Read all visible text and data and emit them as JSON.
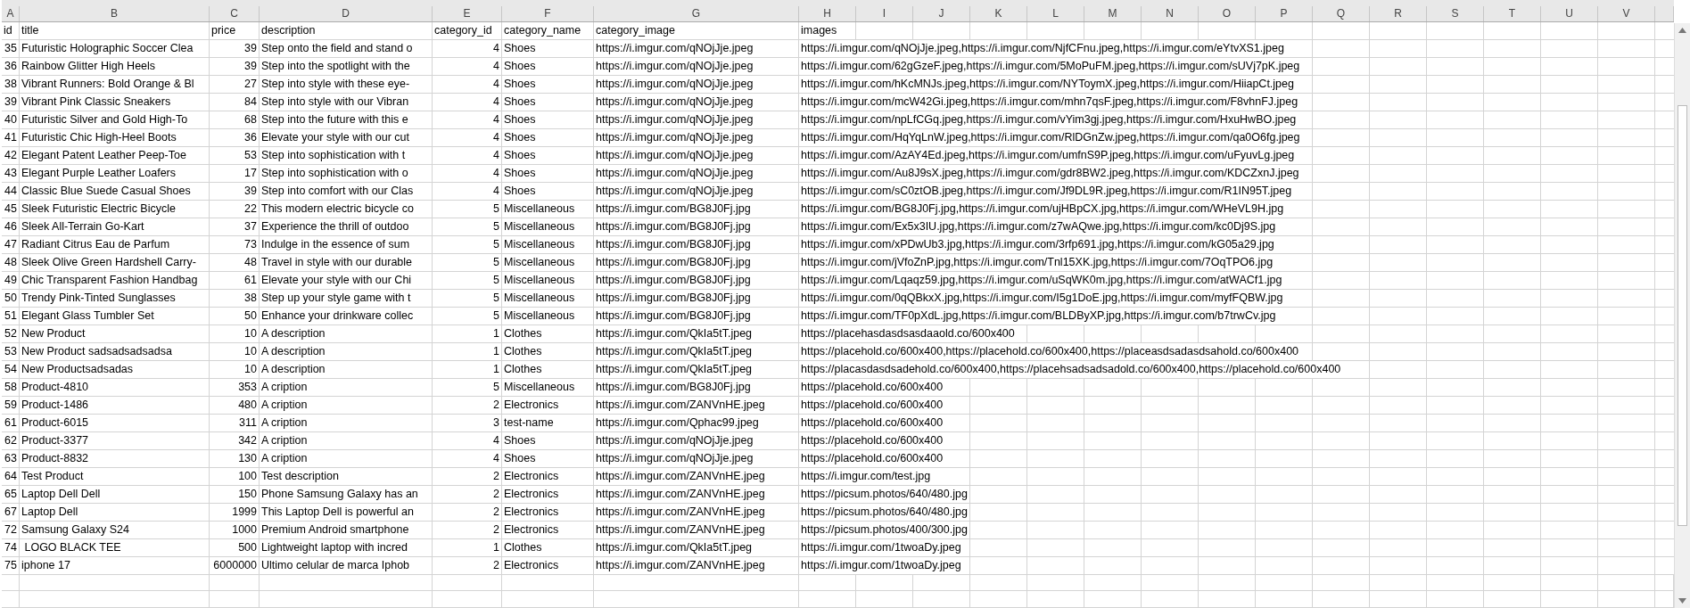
{
  "column_headers": [
    "A",
    "B",
    "C",
    "D",
    "E",
    "F",
    "G",
    "H",
    "I",
    "J",
    "K",
    "L",
    "M",
    "N",
    "O",
    "P",
    "Q",
    "R",
    "S",
    "T",
    "U",
    "V"
  ],
  "table": {
    "columns": [
      "id",
      "title",
      "price",
      "description",
      "category_id",
      "category_name",
      "category_image",
      "images"
    ],
    "rows": [
      [
        "35",
        "Futuristic Holographic Soccer Clea",
        "39",
        "Step onto the field and stand o",
        "4",
        "Shoes",
        "https://i.imgur.com/qNOjJje.jpeg",
        "https://i.imgur.com/qNOjJje.jpeg,https://i.imgur.com/NjfCFnu.jpeg,https://i.imgur.com/eYtvXS1.jpeg"
      ],
      [
        "36",
        "Rainbow Glitter High Heels",
        "39",
        "Step into the spotlight with the",
        "4",
        "Shoes",
        "https://i.imgur.com/qNOjJje.jpeg",
        "https://i.imgur.com/62gGzeF.jpeg,https://i.imgur.com/5MoPuFM.jpeg,https://i.imgur.com/sUVj7pK.jpeg"
      ],
      [
        "38",
        "Vibrant Runners: Bold Orange & Bl",
        "27",
        "Step into style with these eye-",
        "4",
        "Shoes",
        "https://i.imgur.com/qNOjJje.jpeg",
        "https://i.imgur.com/hKcMNJs.jpeg,https://i.imgur.com/NYToymX.jpeg,https://i.imgur.com/HiiapCt.jpeg"
      ],
      [
        "39",
        "Vibrant Pink Classic Sneakers",
        "84",
        "Step into style with our Vibran",
        "4",
        "Shoes",
        "https://i.imgur.com/qNOjJje.jpeg",
        "https://i.imgur.com/mcW42Gi.jpeg,https://i.imgur.com/mhn7qsF.jpeg,https://i.imgur.com/F8vhnFJ.jpeg"
      ],
      [
        "40",
        "Futuristic Silver and Gold High-To",
        "68",
        "Step into the future with this e",
        "4",
        "Shoes",
        "https://i.imgur.com/qNOjJje.jpeg",
        "https://i.imgur.com/npLfCGq.jpeg,https://i.imgur.com/vYim3gj.jpeg,https://i.imgur.com/HxuHwBO.jpeg"
      ],
      [
        "41",
        "Futuristic Chic High-Heel Boots",
        "36",
        "Elevate your style with our cut",
        "4",
        "Shoes",
        "https://i.imgur.com/qNOjJje.jpeg",
        "https://i.imgur.com/HqYqLnW.jpeg,https://i.imgur.com/RlDGnZw.jpeg,https://i.imgur.com/qa0O6fg.jpeg"
      ],
      [
        "42",
        "Elegant Patent Leather Peep-Toe",
        "53",
        "Step into sophistication with t",
        "4",
        "Shoes",
        "https://i.imgur.com/qNOjJje.jpeg",
        "https://i.imgur.com/AzAY4Ed.jpeg,https://i.imgur.com/umfnS9P.jpeg,https://i.imgur.com/uFyuvLg.jpeg"
      ],
      [
        "43",
        "Elegant Purple Leather Loafers",
        "17",
        "Step into sophistication with o",
        "4",
        "Shoes",
        "https://i.imgur.com/qNOjJje.jpeg",
        "https://i.imgur.com/Au8J9sX.jpeg,https://i.imgur.com/gdr8BW2.jpeg,https://i.imgur.com/KDCZxnJ.jpeg"
      ],
      [
        "44",
        "Classic Blue Suede Casual Shoes",
        "39",
        "Step into comfort with our Clas",
        "4",
        "Shoes",
        "https://i.imgur.com/qNOjJje.jpeg",
        "https://i.imgur.com/sC0ztOB.jpeg,https://i.imgur.com/Jf9DL9R.jpeg,https://i.imgur.com/R1IN95T.jpeg"
      ],
      [
        "45",
        "Sleek Futuristic Electric Bicycle",
        "22",
        "This modern electric bicycle co",
        "5",
        "Miscellaneous",
        "https://i.imgur.com/BG8J0Fj.jpg",
        "https://i.imgur.com/BG8J0Fj.jpg,https://i.imgur.com/ujHBpCX.jpg,https://i.imgur.com/WHeVL9H.jpg"
      ],
      [
        "46",
        "Sleek All-Terrain Go-Kart",
        "37",
        "Experience the thrill of outdoo",
        "5",
        "Miscellaneous",
        "https://i.imgur.com/BG8J0Fj.jpg",
        "https://i.imgur.com/Ex5x3IU.jpg,https://i.imgur.com/z7wAQwe.jpg,https://i.imgur.com/kc0Dj9S.jpg"
      ],
      [
        "47",
        "Radiant Citrus Eau de Parfum",
        "73",
        "Indulge in the essence of sum",
        "5",
        "Miscellaneous",
        "https://i.imgur.com/BG8J0Fj.jpg",
        "https://i.imgur.com/xPDwUb3.jpg,https://i.imgur.com/3rfp691.jpg,https://i.imgur.com/kG05a29.jpg"
      ],
      [
        "48",
        "Sleek Olive Green Hardshell Carry-",
        "48",
        "Travel in style with our durable",
        "5",
        "Miscellaneous",
        "https://i.imgur.com/BG8J0Fj.jpg",
        "https://i.imgur.com/jVfoZnP.jpg,https://i.imgur.com/Tnl15XK.jpg,https://i.imgur.com/7OqTPO6.jpg"
      ],
      [
        "49",
        "Chic Transparent Fashion Handbag",
        "61",
        "Elevate your style with our Chi",
        "5",
        "Miscellaneous",
        "https://i.imgur.com/BG8J0Fj.jpg",
        "https://i.imgur.com/Lqaqz59.jpg,https://i.imgur.com/uSqWK0m.jpg,https://i.imgur.com/atWACf1.jpg"
      ],
      [
        "50",
        "Trendy Pink-Tinted Sunglasses",
        "38",
        "Step up your style game with t",
        "5",
        "Miscellaneous",
        "https://i.imgur.com/BG8J0Fj.jpg",
        "https://i.imgur.com/0qQBkxX.jpg,https://i.imgur.com/I5g1DoE.jpg,https://i.imgur.com/myfFQBW.jpg"
      ],
      [
        "51",
        "Elegant Glass Tumbler Set",
        "50",
        "Enhance your drinkware collec",
        "5",
        "Miscellaneous",
        "https://i.imgur.com/BG8J0Fj.jpg",
        "https://i.imgur.com/TF0pXdL.jpg,https://i.imgur.com/BLDByXP.jpg,https://i.imgur.com/b7trwCv.jpg"
      ],
      [
        "52",
        "New Product",
        "10",
        "A description",
        "1",
        "Clothes",
        "https://i.imgur.com/QkIa5tT.jpeg",
        "https://placehasdasdsasdaaold.co/600x400"
      ],
      [
        "53",
        "New Product sadsadsadsadsa",
        "10",
        "A description",
        "1",
        "Clothes",
        "https://i.imgur.com/QkIa5tT.jpeg",
        "https://placehold.co/600x400,https://placehold.co/600x400,https://placeasdsadasdsahold.co/600x400"
      ],
      [
        "54",
        "New Productsadsadas",
        "10",
        "A description",
        "1",
        "Clothes",
        "https://i.imgur.com/QkIa5tT.jpeg",
        "https://placasdasdsadehold.co/600x400,https://placehsadsadsadold.co/600x400,https://placehold.co/600x400"
      ],
      [
        "58",
        "Product-4810",
        "353",
        "A cription",
        "5",
        "Miscellaneous",
        "https://i.imgur.com/BG8J0Fj.jpg",
        "https://placehold.co/600x400"
      ],
      [
        "59",
        "Product-1486",
        "480",
        "A cription",
        "2",
        "Electronics",
        "https://i.imgur.com/ZANVnHE.jpeg",
        "https://placehold.co/600x400"
      ],
      [
        "61",
        "Product-6015",
        "311",
        "A cription",
        "3",
        "test-name",
        "https://i.imgur.com/Qphac99.jpeg",
        "https://placehold.co/600x400"
      ],
      [
        "62",
        "Product-3377",
        "342",
        "A cription",
        "4",
        "Shoes",
        "https://i.imgur.com/qNOjJje.jpeg",
        "https://placehold.co/600x400"
      ],
      [
        "63",
        "Product-8832",
        "130",
        "A cription",
        "4",
        "Shoes",
        "https://i.imgur.com/qNOjJje.jpeg",
        "https://placehold.co/600x400"
      ],
      [
        "64",
        "Test Product",
        "100",
        "Test description",
        "2",
        "Electronics",
        "https://i.imgur.com/ZANVnHE.jpeg",
        "https://i.imgur.com/test.jpg"
      ],
      [
        "65",
        "Laptop Dell Dell",
        "150",
        "Phone Samsung Galaxy has an",
        "2",
        "Electronics",
        "https://i.imgur.com/ZANVnHE.jpeg",
        "https://picsum.photos/640/480.jpg"
      ],
      [
        "67",
        "Laptop Dell",
        "1999",
        "This Laptop Dell is powerful an",
        "2",
        "Electronics",
        "https://i.imgur.com/ZANVnHE.jpeg",
        "https://picsum.photos/640/480.jpg"
      ],
      [
        "72",
        "Samsung Galaxy S24",
        "1000",
        "Premium Android smartphone",
        "2",
        "Electronics",
        "https://i.imgur.com/ZANVnHE.jpeg",
        "https://picsum.photos/400/300.jpg"
      ],
      [
        "74",
        " LOGO BLACK TEE",
        "500",
        "Lightweight laptop with incred",
        "1",
        "Clothes",
        "https://i.imgur.com/QkIa5tT.jpeg",
        "https://i.imgur.com/1twoaDy.jpeg"
      ],
      [
        "75",
        "iphone 17",
        "6000000",
        "Ultimo celular de marca Iphob",
        "2",
        "Electronics",
        "https://i.imgur.com/ZANVnHE.jpeg",
        "https://i.imgur.com/1twoaDy.jpeg"
      ]
    ]
  }
}
